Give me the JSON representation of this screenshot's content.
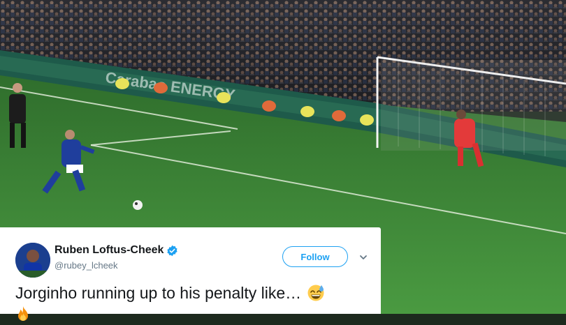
{
  "tweet": {
    "display_name": "Ruben Loftus-Cheek",
    "handle": "@rubey_lcheek",
    "follow_label": "Follow",
    "text": "Jorginho running up to his penalty like…"
  },
  "icons": {
    "verified": "verified-badge-icon",
    "menu": "chevron-down-icon",
    "emoji_1": "grinning-sweat-emoji",
    "emoji_2": "fire-emoji"
  },
  "colors": {
    "accent": "#1da1f2",
    "pitch": "#3f8a3a",
    "stands": "#1e1f24"
  }
}
